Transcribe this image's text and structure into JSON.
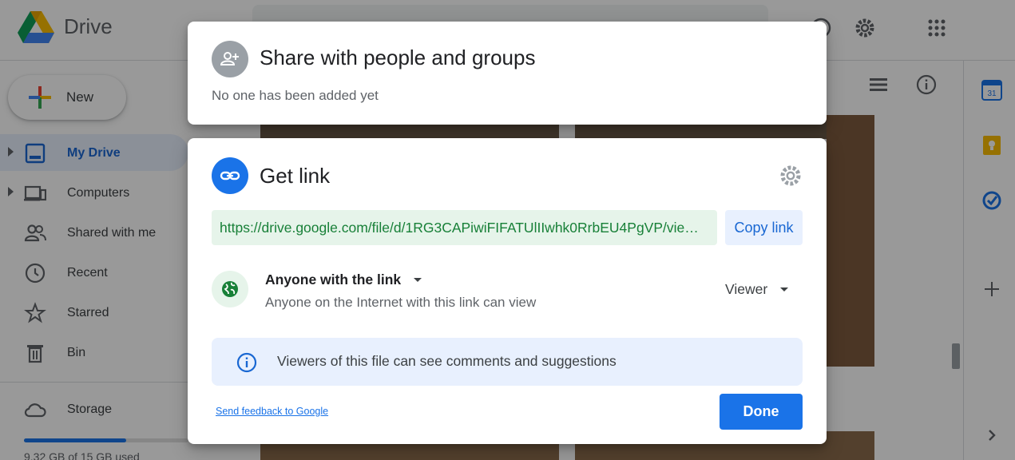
{
  "drive": {
    "app_title": "Drive",
    "new_button_label": "New",
    "nav": [
      {
        "label": "My Drive",
        "icon": "my-drive-icon",
        "active": true
      },
      {
        "label": "Computers",
        "icon": "computers-icon"
      },
      {
        "label": "Shared with me",
        "icon": "shared-with-me-icon"
      },
      {
        "label": "Recent",
        "icon": "clock-icon"
      },
      {
        "label": "Starred",
        "icon": "star-icon"
      },
      {
        "label": "Bin",
        "icon": "trash-icon"
      }
    ],
    "storage_label": "Storage",
    "storage_text": "9.32 GB of 15 GB used",
    "storage_used_fraction": 0.62
  },
  "share": {
    "title": "Share with people and groups",
    "subtitle": "No one has been added yet",
    "icon": "add-person-icon"
  },
  "get_link": {
    "title": "Get link",
    "icon": "link-icon",
    "url": "https://drive.google.com/file/d/1RG3CAPiwiFIFATUlIIwhk0RrbEU4PgVP/vie…",
    "copy_label": "Copy link",
    "access_label": "Anyone with the link",
    "access_description": "Anyone on the Internet with this link can view",
    "role_label": "Viewer",
    "info_text": "Viewers of this file can see comments and suggestions",
    "feedback_label": "Send feedback to Google",
    "done_label": "Done"
  },
  "colors": {
    "accent": "#1a73e8",
    "link_green": "#188038",
    "url_bg": "#e6f4ea",
    "info_bg": "#e8f0fe"
  }
}
